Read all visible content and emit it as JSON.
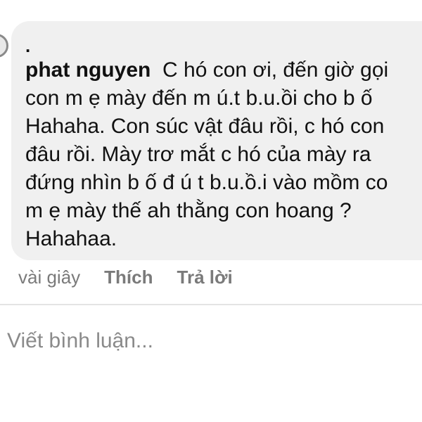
{
  "comment": {
    "marker": ".",
    "author": "phat nguyen",
    "text": "C hó con ơi, đến giờ gọi\ncon m ẹ mày đến m ú.t b.u.ồi cho b ố\nHahaha. Con súc vật đâu rồi, c hó con\nđâu rồi. Mày trơ mắt c hó của mày ra\nđứng nhìn b ố đ ú t b.u.ồ.i vào mồm co\nm ẹ mày thế ah thằng con hoang ?\nHahahaa.",
    "timestamp": "vài giây",
    "like_label": "Thích",
    "reply_label": "Trả lời"
  },
  "composer": {
    "placeholder": "Viết bình luận..."
  }
}
